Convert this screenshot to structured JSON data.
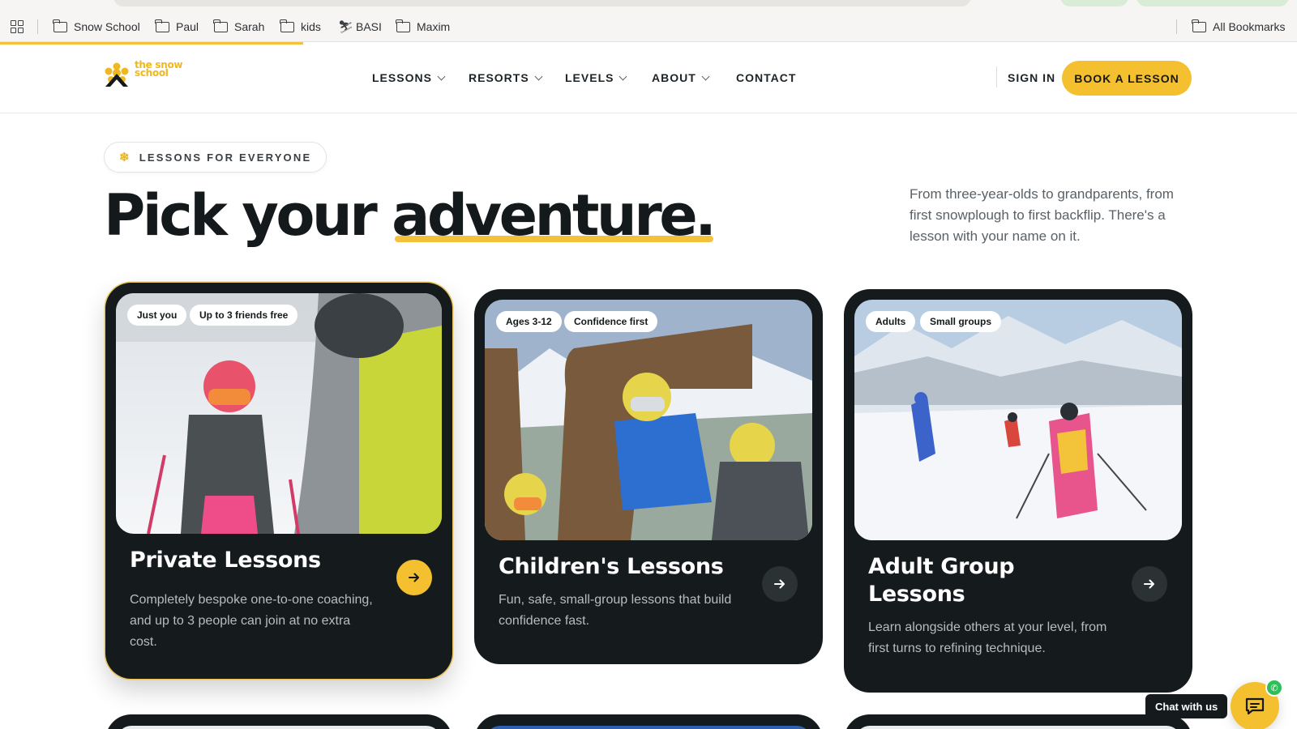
{
  "browser": {
    "bookmarks": [
      {
        "label": "Snow School",
        "icon": "folder-icon"
      },
      {
        "label": "Paul",
        "icon": "folder-icon"
      },
      {
        "label": "Sarah",
        "icon": "folder-icon"
      },
      {
        "label": "kids",
        "icon": "folder-icon"
      },
      {
        "label": "BASI",
        "icon": "skier-icon"
      },
      {
        "label": "Maxim",
        "icon": "folder-icon"
      }
    ],
    "all_bookmarks_label": "All Bookmarks"
  },
  "header": {
    "logo_text": "the snow school",
    "nav": [
      {
        "label": "LESSONS",
        "has_dropdown": true
      },
      {
        "label": "RESORTS",
        "has_dropdown": true
      },
      {
        "label": "LEVELS",
        "has_dropdown": true
      },
      {
        "label": "ABOUT",
        "has_dropdown": true
      },
      {
        "label": "CONTACT",
        "has_dropdown": false
      }
    ],
    "sign_in": "SIGN IN",
    "cta": "BOOK A LESSON"
  },
  "hero": {
    "eyebrow": "LESSONS FOR EVERYONE",
    "title_plain": "Pick your ",
    "title_highlight": "adventure.",
    "description": "From three-year-olds to grandparents, from first snowplough to first backflip. There's a lesson with your name on it."
  },
  "cards": [
    {
      "title": "Private Lessons",
      "tags": [
        "Just you",
        "Up to 3 friends free"
      ],
      "description": "Completely bespoke one-to-one coaching, and up to 3 people can join at no extra cost.",
      "featured": true
    },
    {
      "title": "Children's Lessons",
      "tags": [
        "Ages 3-12",
        "Confidence first"
      ],
      "description": "Fun, safe, small-group lessons that build confidence fast.",
      "featured": false
    },
    {
      "title": "Adult Group Lessons",
      "tags": [
        "Adults",
        "Small groups"
      ],
      "description": "Learn alongside others at your level, from first turns to refining technique.",
      "featured": false
    }
  ],
  "chat": {
    "label": "Chat with us"
  },
  "colors": {
    "brand_yellow": "#f5c02f",
    "card_dark": "#151b1d",
    "text_dark": "#14191b"
  }
}
